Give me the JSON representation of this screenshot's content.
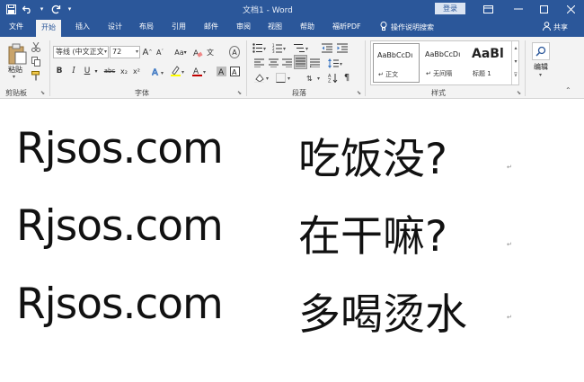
{
  "window": {
    "title": "文档1 - Word",
    "login_label": "登录",
    "buttons": [
      "ribbon-display-icon",
      "minimize-icon",
      "maximize-icon",
      "close-icon"
    ]
  },
  "quick_access": {
    "icons": [
      "save-icon",
      "undo-icon",
      "redo-icon",
      "customize-icon"
    ]
  },
  "tabs": {
    "file": "文件",
    "home": "开始",
    "insert": "插入",
    "design": "设计",
    "layout": "布局",
    "references": "引用",
    "mailings": "邮件",
    "review": "审阅",
    "view": "视图",
    "help": "帮助",
    "foxit": "福昕PDF",
    "tell_me": "操作说明搜索",
    "share": "共享",
    "active": "开始"
  },
  "ribbon": {
    "clipboard": {
      "label": "剪贴板",
      "paste": "粘贴"
    },
    "font": {
      "label": "字体",
      "font_name": "等线 (中文正文",
      "font_size": "72",
      "bold": "B",
      "italic": "I",
      "underline": "U",
      "strikethrough": "abc",
      "subscript": "x₂",
      "superscript": "x²",
      "grow": "A",
      "shrink": "A",
      "case": "Aa",
      "clear": "A",
      "phonetic": "文",
      "enclose": "A"
    },
    "paragraph": {
      "label": "段落"
    },
    "styles": {
      "label": "样式",
      "items": [
        {
          "sample": "AaBbCcDı",
          "name": "↵ 正文"
        },
        {
          "sample": "AaBbCcDı",
          "name": "↵ 无间隔"
        },
        {
          "sample": "AaBl",
          "name": "标题 1"
        }
      ]
    },
    "editing": {
      "label": "编辑"
    }
  },
  "document": {
    "lines": [
      {
        "latin": "Rjsos.com",
        "cjk": "吃饭没?"
      },
      {
        "latin": "Rjsos.com",
        "cjk": "在干嘛?"
      },
      {
        "latin": "Rjsos.com",
        "cjk": "多喝烫水"
      }
    ],
    "paragraph_mark": "↵"
  },
  "colors": {
    "accent": "#2b579a",
    "ribbon_bg": "#f3f3f3",
    "font_color": "#c00000",
    "highlight": "#ffff00"
  }
}
